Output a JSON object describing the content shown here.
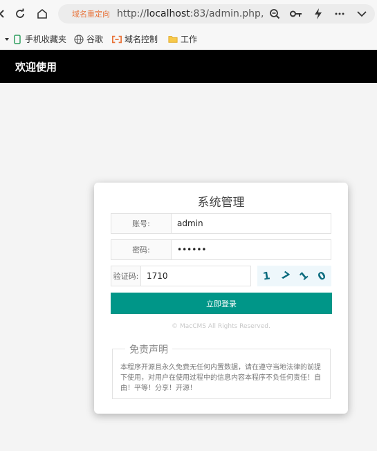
{
  "browser": {
    "redirect_label": "域名重定向",
    "url_prefix": "http://",
    "url_host": "localhost",
    "url_rest": ":83/admin.php,"
  },
  "bookmarks": [
    {
      "label": "手机收藏夹",
      "icon": "phone-icon"
    },
    {
      "label": "谷歌",
      "icon": "globe-icon"
    },
    {
      "label": "域名控制",
      "icon": "link-icon"
    },
    {
      "label": "工作",
      "icon": "folder-icon"
    }
  ],
  "header": {
    "title": "欢迎使用"
  },
  "login": {
    "title": "系统管理",
    "account_label": "账号:",
    "account_value": "admin",
    "password_label": "密码:",
    "password_value": "123456",
    "captcha_label": "验证码:",
    "captcha_value": "1710",
    "captcha_image_text": [
      "1",
      "7",
      "1",
      "0"
    ],
    "submit_label": "立即登录",
    "copyright": "© MacCMS All Rights Reserved."
  },
  "disclaimer": {
    "title": "免责声明",
    "text": "本程序开源且永久免费无任何内置数据，请在遵守当地法律的前提下使用，对用户在使用过程中的信息内容本程序不负任何责任！自由！平等！分享！开源！"
  },
  "colors": {
    "header_bg": "#000000",
    "button_bg": "#009688",
    "redirect_text": "#e8743b"
  }
}
